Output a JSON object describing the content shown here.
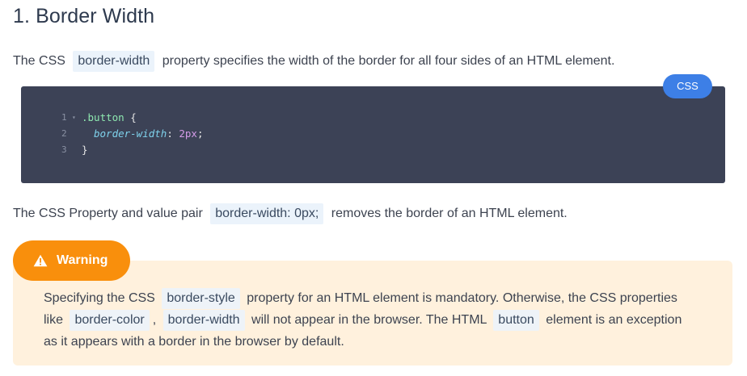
{
  "heading": "1. Border Width",
  "paragraph1": {
    "before": "The CSS",
    "code": "border-width",
    "after": "property specifies the width of the border for all four sides of an HTML element."
  },
  "code_block": {
    "language": "CSS",
    "lines": [
      {
        "number": "1",
        "fold": "▾",
        "selector": ".button",
        "brace_open": " {"
      },
      {
        "number": "2",
        "property": "border-width",
        "colon": ": ",
        "value": "2px",
        "semicolon": ";"
      },
      {
        "number": "3",
        "brace_close": "}"
      }
    ]
  },
  "paragraph2": {
    "before": "The CSS Property and value pair",
    "code": "border-width: 0px;",
    "after": "removes the border of an HTML element."
  },
  "warning": {
    "label": "Warning",
    "icon": "warning-triangle-icon",
    "seg1": "Specifying the CSS",
    "code1": "border-style",
    "seg2": "property for an HTML element is mandatory. Otherwise, the CSS properties like",
    "code2": "border-color",
    "seg3": ",",
    "code3": "border-width",
    "seg4": "will not appear in the browser. The HTML",
    "code4": "button",
    "seg5": "element is an exception as it appears with a border in the browser by default."
  },
  "colors": {
    "code_bg": "#3c4256",
    "badge_bg": "#3d7fe6",
    "warning_accent": "#f98f0c",
    "warning_bg": "#fff1dd",
    "inline_code_bg": "#ebf3fb"
  }
}
